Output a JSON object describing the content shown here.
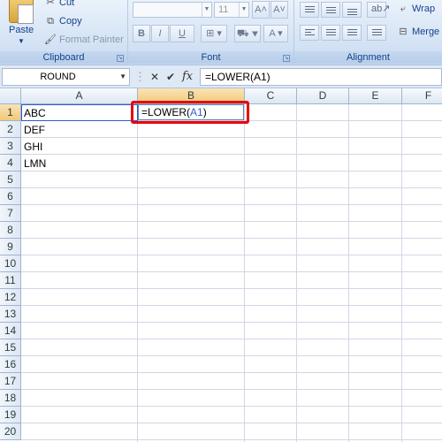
{
  "ribbon": {
    "clipboard": {
      "paste_label": "Paste",
      "cut_label": "Cut",
      "copy_label": "Copy",
      "format_painter_label": "Format Painter",
      "group_label": "Clipboard"
    },
    "font": {
      "size_value": "11",
      "bold_label": "B",
      "italic_label": "I",
      "underline_label": "U",
      "grow_label": "A˄",
      "shrink_label": "A˅",
      "group_label": "Font"
    },
    "alignment": {
      "wrap_label": "Wrap",
      "merge_label": "Merge",
      "group_label": "Alignment"
    }
  },
  "formula_bar": {
    "name_box": "ROUND",
    "cancel_symbol": "✕",
    "enter_symbol": "✔",
    "fx_symbol": "fx",
    "formula": "=LOWER(A1)"
  },
  "sheet": {
    "columns": [
      "A",
      "B",
      "C",
      "D",
      "E",
      "F"
    ],
    "active_column": "B",
    "rows": [
      "1",
      "2",
      "3",
      "4",
      "5",
      "6",
      "7",
      "8",
      "9",
      "10",
      "11",
      "12",
      "13",
      "14",
      "15",
      "16",
      "17",
      "18",
      "19",
      "20"
    ],
    "active_row": "1",
    "cells": {
      "A1": "ABC",
      "A2": "DEF",
      "A3": "GHI",
      "A4": "LMN"
    },
    "editing_cell": {
      "prefix": "=LOWER(",
      "ref": "A1",
      "suffix": ")"
    }
  },
  "colors": {
    "highlight": "#e8000b",
    "reference": "#2f5bd1",
    "ribbon": "#d6e4f5"
  }
}
